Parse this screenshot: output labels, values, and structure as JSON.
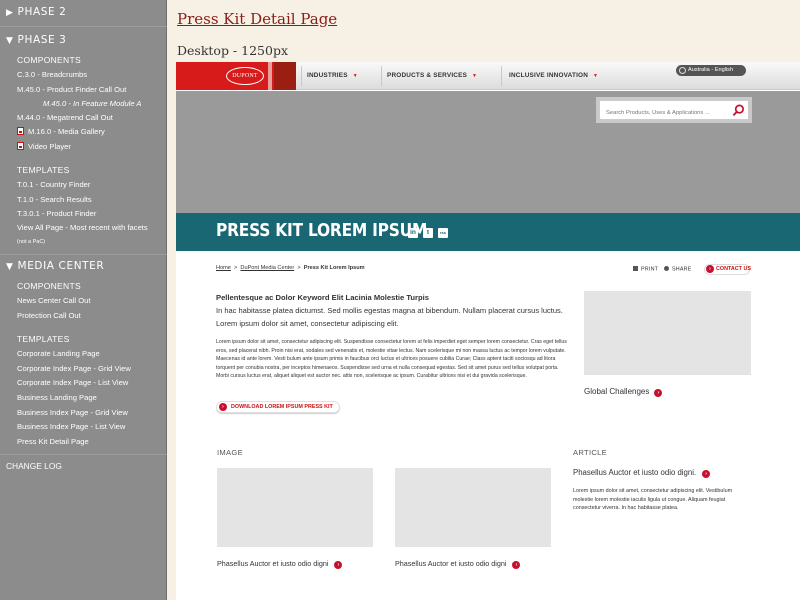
{
  "sidebar": {
    "phase2": "PHASE 2",
    "phase3": "PHASE 3",
    "phase3_components_head": "COMPONENTS",
    "phase3_components": [
      "C.3.0 - Breadcrumbs",
      "M.45.0 - Product Finder Call Out",
      "M.45.0 - In Feature Module A",
      "M.44.0 - Megatrend Call Out",
      "M.16.0 - Media Gallery",
      "Video Player"
    ],
    "phase3_templates_head": "TEMPLATES",
    "phase3_templates": [
      "T.0.1 - Country Finder",
      "T.1.0 - Search Results",
      "T.3.0.1 - Product Finder",
      "View All Page - Most recent with facets",
      "(not a PaC)"
    ],
    "media_center": "MEDIA CENTER",
    "mc_components_head": "COMPONENTS",
    "mc_components": [
      "News Center Call Out",
      "Protection Call Out"
    ],
    "mc_templates_head": "TEMPLATES",
    "mc_templates": [
      "Corporate Landing Page",
      "Corporate Index Page - Grid View",
      "Corporate Index Page - List View",
      "Business Landing Page",
      "Business Index Page - Grid View",
      "Business Index Page - List View",
      "Press Kit Detail Page"
    ],
    "change_log": "CHANGE LOG"
  },
  "page_title": "Press Kit Detail Page",
  "page_subtitle": "Desktop - 1250px",
  "mockup": {
    "logo_text": "DUPONT",
    "nav": [
      "INDUSTRIES",
      "PRODUCTS & SERVICES",
      "INCLUSIVE INNOVATION"
    ],
    "locale": "Australia - English",
    "search_placeholder": "Search Products, Uses & Applications ...",
    "hero_title": "PRESS KIT LOREM IPSUM",
    "social": [
      "in",
      "t",
      "rss"
    ],
    "breadcrumb": {
      "home": "Home",
      "sep1": ">",
      "media_center": "DuPont Media Center",
      "sep2": ">",
      "current": "Press Kit Lorem Ipsum"
    },
    "print": "PRINT",
    "share": "SHARE",
    "contact": "CONTACT US",
    "intro_heading": "Pellentesque ac Dolor Keyword Elit Lacinia Molestie Turpis",
    "intro_text": "In hac habitasse platea dictumst. Sed mollis egestas magna at bibendum. Nullam placerat cursus luctus. Lorem ipsum dolor sit amet, consectetur adipiscing elit.",
    "body_text": "Lorem ipsum dolor sit amet, consectetur adipiscing elit. Suspendisse consectetur lorem ut felis imperdiet eget semper lorem consectetur. Cras eget tellus eros, sed placerat nibh. Proin nisi erat, sodales sed venenatis et, molestie vitae lectus. Nam scelerisque mi non massa luctus ac tempor lorem vulputate. Maecenas id ante lorem. Vesti bulum ante ipsum primis in faucibus orci luctus et ultrices posuere cubilia Curae; Class aptent taciti sociosqu ad litora torquent per conubia nostra, per inceptos himenaeos. Suspendisse sed urna et nulla consequat egestas. Sed sit amet purus sed tellus volutpat porta. Morbi cursus luctus erat, aliquet aliquet est auctor nec. attis non, scelerisque ac ipsum. Curabitur ultrices nisi et dui gravida scelerisque.",
    "download": "DOWNLOAD LOREM IPSUM PRESS KIT",
    "global_challenges": "Global Challenges",
    "image_label": "IMAGE",
    "article_label": "ARTICLE",
    "image_caption_1": "Phasellus Auctor et iusto odio digni",
    "image_caption_2": "Phasellus Auctor et iusto odio digni",
    "article_title": "Phasellus Auctor et iusto odio digni.",
    "article_text": "Lorem ipsum dolor sit amet, consectetur adipiscing elit. Vestibulum molestie lorem molestie iaculis ligula ut congue. Aliquam feugiat consectetur viverra. In hac habitasse platea."
  },
  "colors": {
    "sidebar_bg": "#8c8c8c",
    "page_bg": "#f6f1e4",
    "title_red": "#8a1d16",
    "brand_red": "#d71a1a",
    "teal": "#186773",
    "hero_gray": "#9a9a9a",
    "placeholder_gray": "#e4e4e4"
  }
}
